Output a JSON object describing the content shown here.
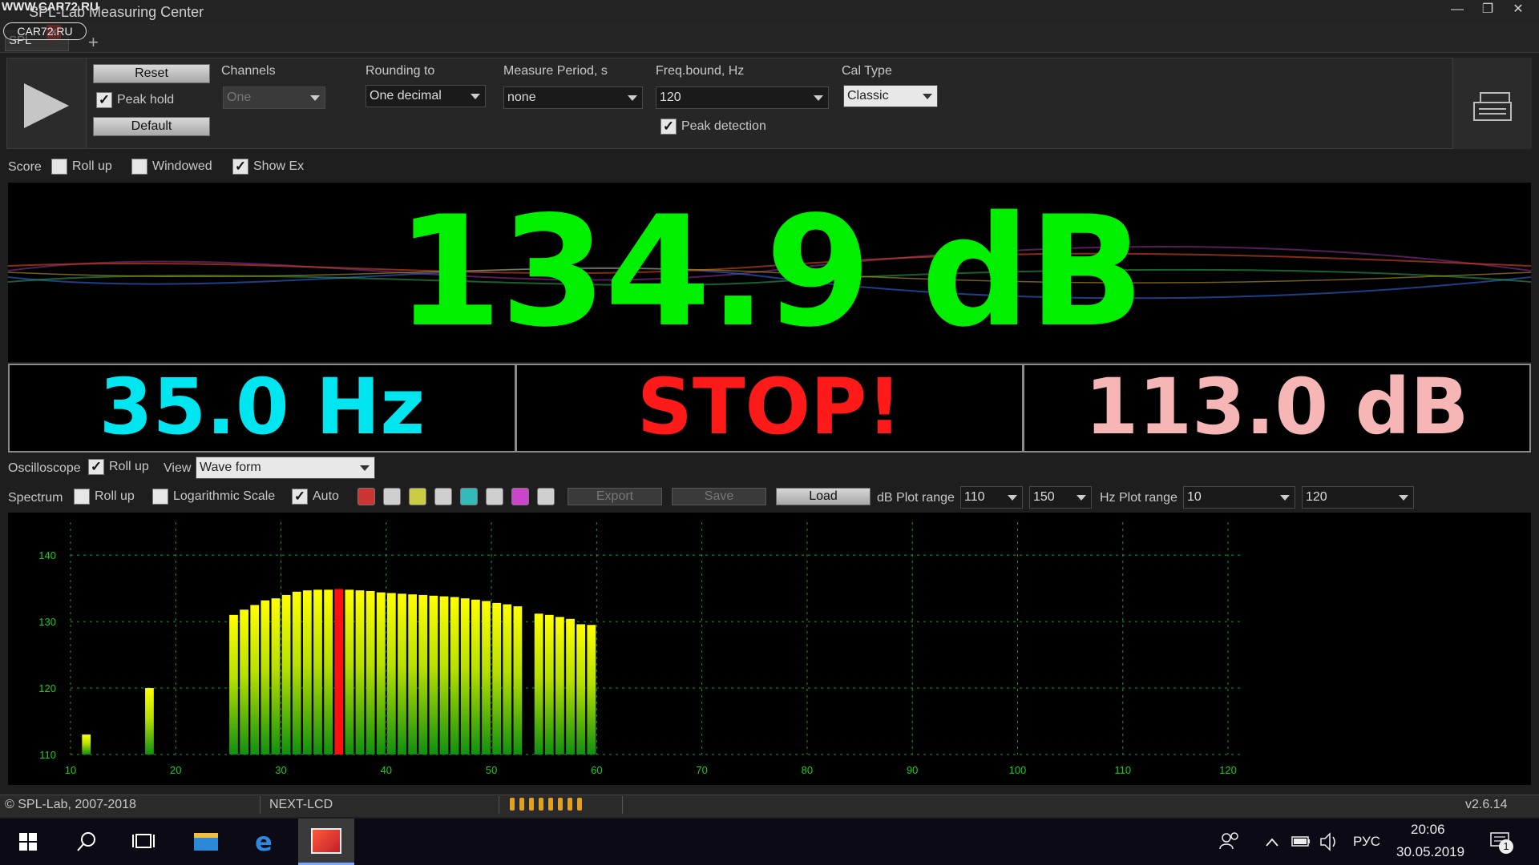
{
  "window": {
    "watermark": "WWW.CAR72.RU",
    "title": "SPL-Lab Measuring Center",
    "min": "—",
    "restore": "❐",
    "close": "✕"
  },
  "tabs": {
    "active": "SPL",
    "close": "✕",
    "add": "+",
    "logo": "CAR72.RU"
  },
  "controls": {
    "reset": "Reset",
    "peak_hold": "Peak hold",
    "default": "Default",
    "channels_label": "Channels",
    "channels_value": "One",
    "rounding_label": "Rounding to",
    "rounding_value": "One decimal",
    "period_label": "Measure Period, s",
    "period_value": "none",
    "freq_label": "Freq.bound, Hz",
    "freq_value": "120",
    "peak_detection": "Peak detection",
    "caltype_label": "Cal Type",
    "caltype_value": "Classic"
  },
  "score_row": {
    "score": "Score",
    "rollup": "Roll up",
    "windowed": "Windowed",
    "showex": "Show Ex"
  },
  "display": {
    "main": "134.9 dB",
    "frequency": "35.0 Hz",
    "status": "STOP!",
    "secondary": "113.0 dB",
    "main_color": "#00f000",
    "frequency_color": "#00e6f0",
    "status_color": "#ff1a1a",
    "secondary_color": "#f7b6b6"
  },
  "oscilloscope": {
    "label": "Oscilloscope",
    "rollup": "Roll up",
    "view_label": "View",
    "view_value": "Wave form"
  },
  "spectrum_row": {
    "label": "Spectrum",
    "rollup": "Roll up",
    "log": "Logarithmic Scale",
    "auto": "Auto",
    "colors": [
      "#cc3333",
      "#cccc44",
      "#33bbbb",
      "#cc44cc"
    ],
    "export": "Export",
    "save": "Save",
    "load": "Load",
    "db_range_label": "dB Plot range",
    "db_min": "110",
    "db_max": "150",
    "hz_range_label": "Hz Plot range",
    "hz_min": "10",
    "hz_max": "120"
  },
  "chart_data": {
    "type": "bar",
    "xlabel": "",
    "ylabel": "",
    "xlim": [
      10,
      120
    ],
    "ylim": [
      110,
      144
    ],
    "x_ticks": [
      10,
      20,
      30,
      40,
      50,
      60,
      70,
      80,
      90,
      100,
      110,
      120
    ],
    "y_ticks": [
      110,
      120,
      130,
      140
    ],
    "grid": true,
    "highlight_x": 35,
    "x": [
      11.5,
      17.5,
      25.5,
      26.5,
      27.5,
      28.5,
      29.5,
      30.5,
      31.5,
      32.5,
      33.5,
      34.5,
      35.5,
      36.5,
      37.5,
      38.5,
      39.5,
      40.5,
      41.5,
      42.5,
      43.5,
      44.5,
      45.5,
      46.5,
      47.5,
      48.5,
      49.5,
      50.5,
      51.5,
      52.5,
      54.5,
      55.5,
      56.5,
      57.5,
      58.5,
      59.5
    ],
    "values": [
      113.0,
      120.0,
      131.0,
      131.8,
      132.5,
      133.2,
      133.5,
      134.0,
      134.5,
      134.7,
      134.8,
      134.8,
      134.9,
      134.8,
      134.7,
      134.6,
      134.4,
      134.3,
      134.2,
      134.1,
      134.0,
      133.9,
      133.8,
      133.7,
      133.5,
      133.3,
      133.1,
      132.8,
      132.6,
      132.3,
      131.2,
      131.0,
      130.7,
      130.4,
      129.6,
      129.5
    ]
  },
  "statusbar": {
    "copyright": "© SPL-Lab, 2007-2018",
    "device": "NEXT-LCD",
    "version": "v2.6.14"
  },
  "taskbar": {
    "lang": "РУС",
    "time": "20:06",
    "date": "30.05.2019",
    "notif_count": "1"
  }
}
